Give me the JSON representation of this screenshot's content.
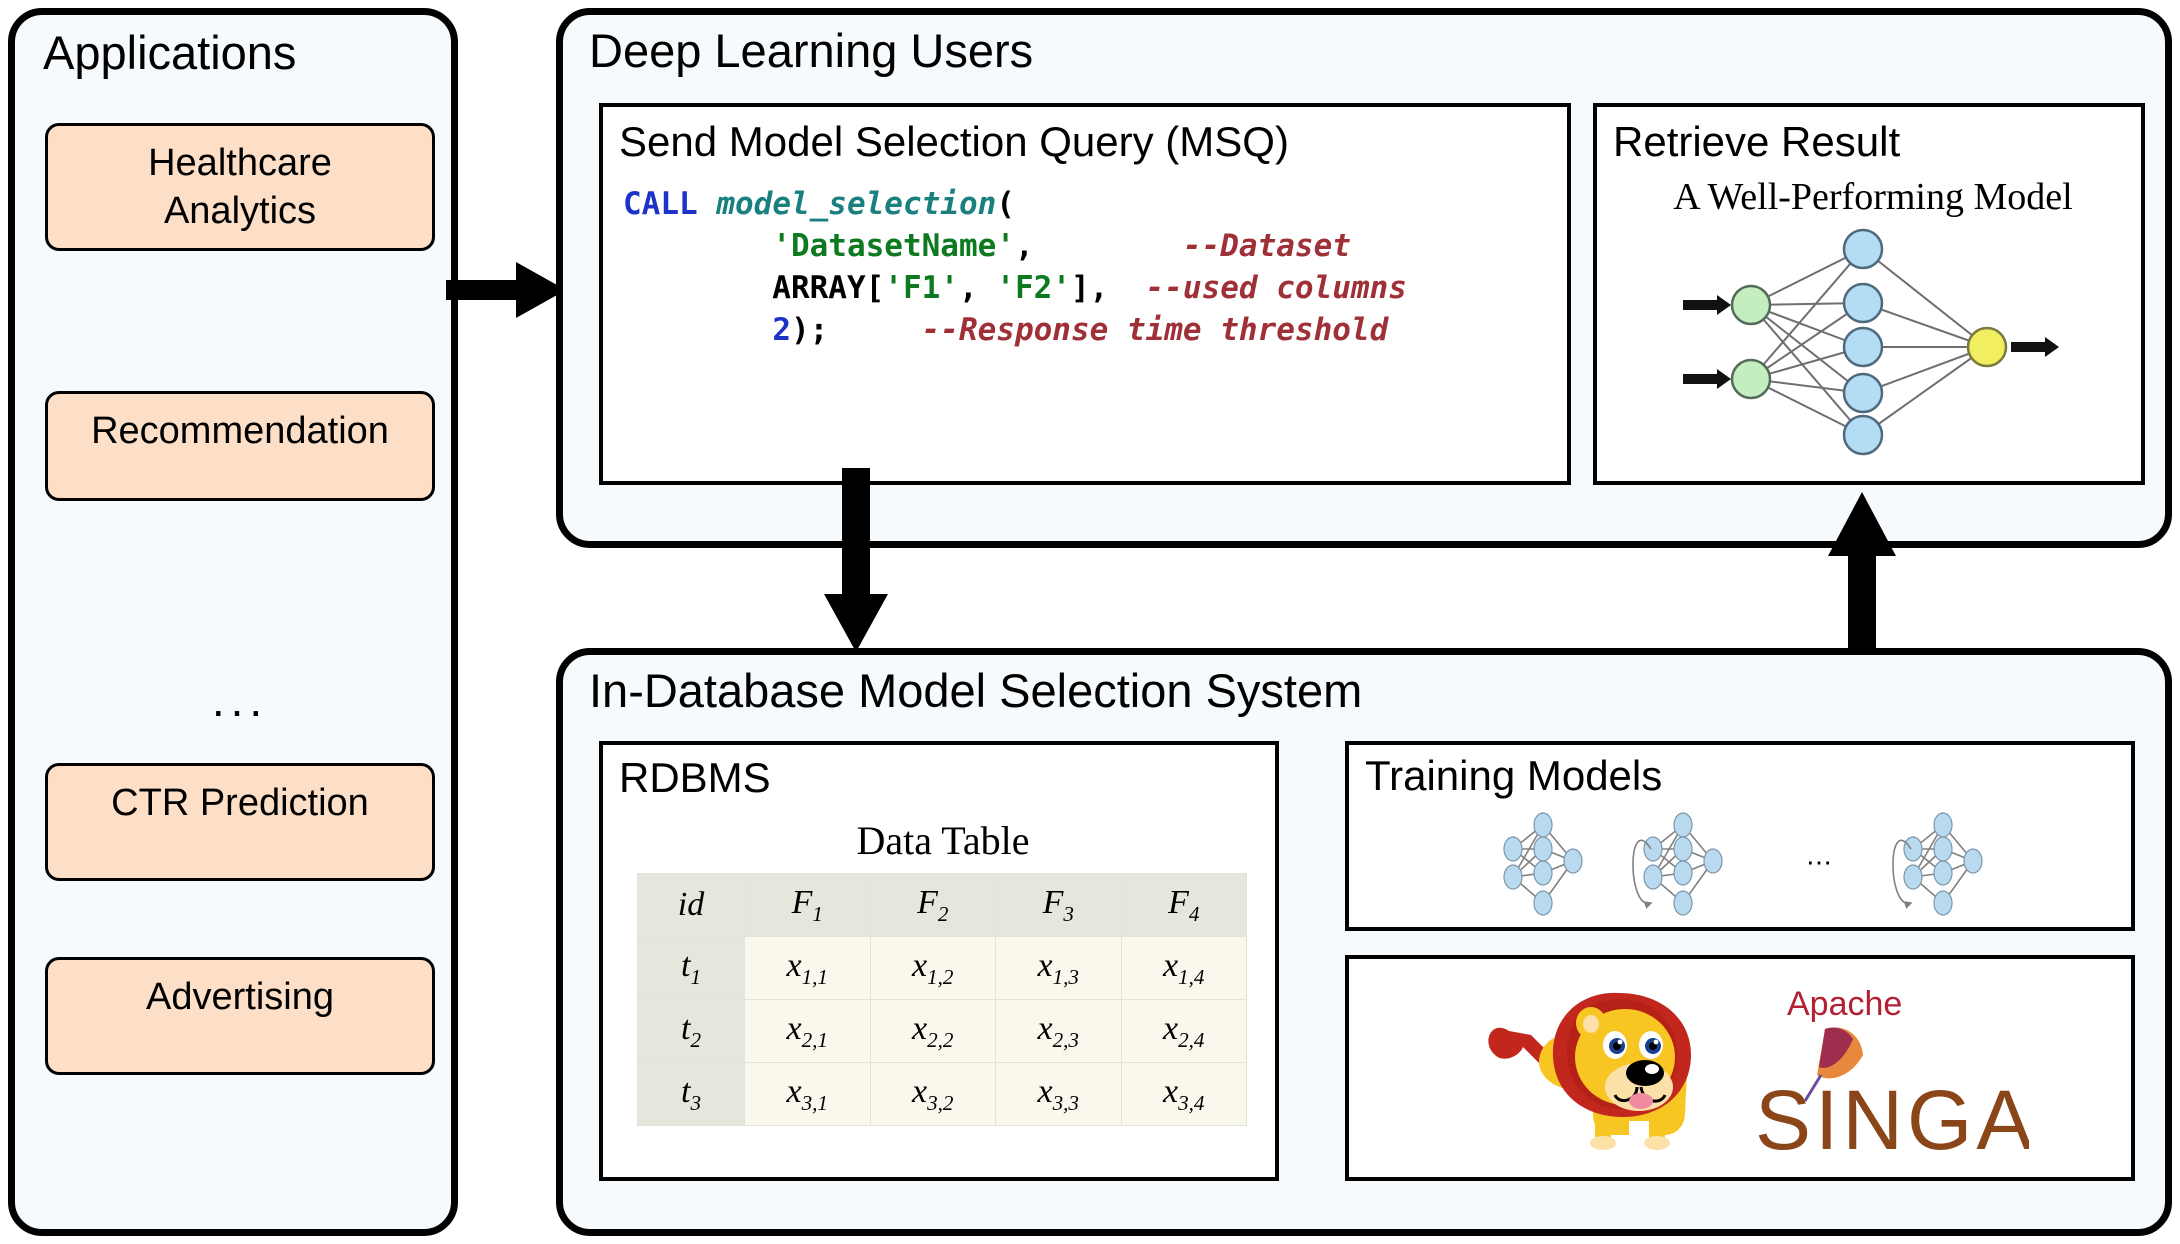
{
  "applications": {
    "title": "Applications",
    "ellipsis": "...",
    "items": [
      {
        "label": "Healthcare\nAnalytics"
      },
      {
        "label": "Recommendation"
      },
      {
        "label": "CTR Prediction"
      },
      {
        "label": "Advertising"
      }
    ],
    "box_fill": "#fcdfc6"
  },
  "dl_users": {
    "title": "Deep Learning Users",
    "msq": {
      "title": "Send Model Selection Query (MSQ)",
      "code_lines": [
        {
          "tokens": [
            {
              "text": "CALL ",
              "type": "keyword"
            },
            {
              "text": "model_selection",
              "type": "function"
            },
            {
              "text": "(",
              "type": "plain"
            }
          ]
        },
        {
          "tokens": [
            {
              "text": "        ",
              "type": "plain"
            },
            {
              "text": "'DatasetName'",
              "type": "string"
            },
            {
              "text": ",        ",
              "type": "plain"
            },
            {
              "text": "--Dataset",
              "type": "comment"
            }
          ]
        },
        {
          "tokens": [
            {
              "text": "        ARRAY[",
              "type": "plain"
            },
            {
              "text": "'F1'",
              "type": "string"
            },
            {
              "text": ", ",
              "type": "plain"
            },
            {
              "text": "'F2'",
              "type": "string"
            },
            {
              "text": "],  ",
              "type": "plain"
            },
            {
              "text": "--used columns",
              "type": "comment"
            }
          ]
        },
        {
          "tokens": [
            {
              "text": "        ",
              "type": "plain"
            },
            {
              "text": "2",
              "type": "number"
            },
            {
              "text": ");     ",
              "type": "plain"
            },
            {
              "text": "--Response time threshold",
              "type": "comment"
            }
          ]
        }
      ],
      "code_plain_text": "CALL model_selection(\n        'DatasetName',        --Dataset\n        ARRAY['F1', 'F2'],  --used columns\n        2);     --Response time threshold",
      "colors": {
        "keyword": "#1c32c8",
        "function": "#1a7f7f",
        "string": "#0e7a20",
        "number": "#1c32c8",
        "comment": "#a03038",
        "plain": "#000000"
      }
    },
    "retrieve": {
      "title": "Retrieve Result",
      "subtitle": "A Well-Performing Model",
      "network": {
        "input_nodes": 2,
        "hidden_nodes": 5,
        "output_nodes": 1,
        "input_color": "#c5eec0",
        "hidden_color": "#b5dcf5",
        "output_color": "#f2ee62",
        "edge_color": "#6f6f6f"
      }
    }
  },
  "system": {
    "title": "In-Database Model Selection System",
    "rdbms": {
      "title": "RDBMS",
      "table_caption": "Data Table",
      "columns": [
        "id",
        "F1",
        "F2",
        "F3",
        "F4"
      ],
      "column_display": [
        {
          "base": "id",
          "sub": ""
        },
        {
          "base": "F",
          "sub": "1"
        },
        {
          "base": "F",
          "sub": "2"
        },
        {
          "base": "F",
          "sub": "3"
        },
        {
          "base": "F",
          "sub": "4"
        }
      ],
      "rows": [
        [
          {
            "base": "t",
            "sub": "1"
          },
          {
            "base": "x",
            "sub": "1,1"
          },
          {
            "base": "x",
            "sub": "1,2"
          },
          {
            "base": "x",
            "sub": "1,3"
          },
          {
            "base": "x",
            "sub": "1,4"
          }
        ],
        [
          {
            "base": "t",
            "sub": "2"
          },
          {
            "base": "x",
            "sub": "2,1"
          },
          {
            "base": "x",
            "sub": "2,2"
          },
          {
            "base": "x",
            "sub": "2,3"
          },
          {
            "base": "x",
            "sub": "2,4"
          }
        ],
        [
          {
            "base": "t",
            "sub": "3"
          },
          {
            "base": "x",
            "sub": "3,1"
          },
          {
            "base": "x",
            "sub": "3,2"
          },
          {
            "base": "x",
            "sub": "3,3"
          },
          {
            "base": "x",
            "sub": "3,4"
          }
        ]
      ],
      "header_fill": "#e6e7dc",
      "cell_fill": "#faf8ec"
    },
    "training": {
      "title": "Training Models",
      "network_count": 3,
      "ellipsis": "...",
      "node_color": "#b9d9ef",
      "edge_color": "#808080"
    },
    "singa": {
      "apache_label": "Apache",
      "product_label": "SINGA",
      "apache_color": "#b32033",
      "product_color": "#8a4518",
      "mane_color": "#c1271d",
      "body_color": "#f7c623"
    }
  },
  "arrows": {
    "apps_to_users": "right",
    "users_to_system": "down",
    "system_to_users": "up"
  }
}
